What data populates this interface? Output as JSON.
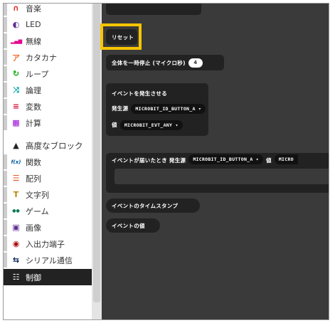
{
  "sidebar": {
    "items": [
      {
        "label": "音楽",
        "icon": "headphones-icon",
        "glyph": "∩",
        "color": "#e63022"
      },
      {
        "label": "LED",
        "icon": "toggle-icon",
        "glyph": "◐",
        "color": "#5c2d91"
      },
      {
        "label": "無線",
        "icon": "signal-icon",
        "glyph": "▂▄▆",
        "color": "#e3008c"
      },
      {
        "label": "カタカナ",
        "icon": "katakana-a-icon",
        "glyph": "ア",
        "color": "#f26b2b"
      },
      {
        "label": "ループ",
        "icon": "refresh-icon",
        "glyph": "↻",
        "color": "#00aa00"
      },
      {
        "label": "論理",
        "icon": "shuffle-icon",
        "glyph": "⤨",
        "color": "#00a4a6"
      },
      {
        "label": "変数",
        "icon": "list-icon",
        "glyph": "≡",
        "color": "#dc143c"
      },
      {
        "label": "計算",
        "icon": "calculator-icon",
        "glyph": "▦",
        "color": "#9400d3"
      },
      {
        "label": "高度なブロック",
        "icon": "chevron-up-icon",
        "glyph": "▲",
        "color": "#222222"
      },
      {
        "label": "関数",
        "icon": "function-icon",
        "glyph": "f(x)",
        "color": "#005a9e"
      },
      {
        "label": "配列",
        "icon": "array-list-icon",
        "glyph": "☰",
        "color": "#e65722"
      },
      {
        "label": "文字列",
        "icon": "text-icon",
        "glyph": "T",
        "color": "#b8860b"
      },
      {
        "label": "ゲーム",
        "icon": "gamepad-icon",
        "glyph": "●●",
        "color": "#007a4b"
      },
      {
        "label": "画像",
        "icon": "image-icon",
        "glyph": "▣",
        "color": "#5c2d91"
      },
      {
        "label": "入出力端子",
        "icon": "target-icon",
        "glyph": "◉",
        "color": "#a80000"
      },
      {
        "label": "シリアル通信",
        "icon": "usb-icon",
        "glyph": "⇆",
        "color": "#002050"
      },
      {
        "label": "制御",
        "icon": "control-panel-icon",
        "glyph": "☷",
        "color": "#ffffff"
      }
    ]
  },
  "flyout": {
    "reset_label": "リセット",
    "pause_label": "全体を一時停止 (マイクロ秒)",
    "pause_value": "4",
    "raise_event_label": "イベントを発生させる",
    "source_label": "発生源",
    "source_value": "MICROBIT_ID_BUTTON_A ▾",
    "value_label": "値",
    "value_value": "MICROBIT_EVT_ANY ▾",
    "on_event_label": "イベントが届いたとき 発生源",
    "on_event_source": "MICROBIT_ID_BUTTON_A ▾",
    "on_event_value_label": "値",
    "on_event_value": "MICRO",
    "timestamp_label": "イベントのタイムスタンプ",
    "event_value_label": "イベントの値"
  },
  "colors": {
    "workspace_bg": "#3a3a3a",
    "block_bg": "#222222",
    "highlight": "#f7c500"
  }
}
